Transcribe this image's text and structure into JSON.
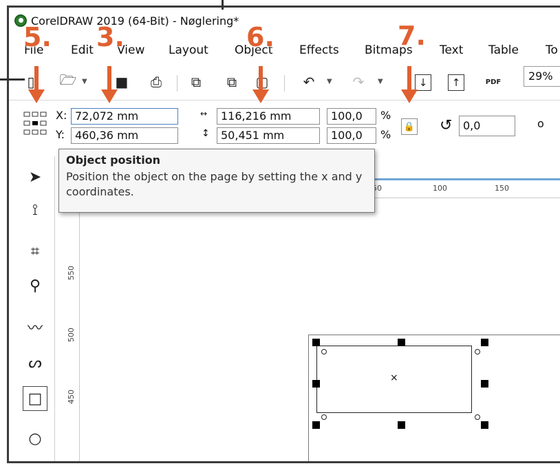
{
  "window": {
    "title": "CorelDRAW 2019 (64-Bit) - Nøglering*"
  },
  "menu": [
    "File",
    "Edit",
    "View",
    "Layout",
    "Object",
    "Effects",
    "Bitmaps",
    "Text",
    "Table",
    "To"
  ],
  "toolbar": {
    "zoom": "29%",
    "pdf_label": "PDF"
  },
  "properties": {
    "x_label": "X:",
    "x_value": "72,072 mm",
    "y_label": "Y:",
    "y_value": "460,36 mm",
    "width_value": "116,216 mm",
    "height_value": "50,451 mm",
    "scale_w": "100,0",
    "scale_h": "100,0",
    "pct": "%",
    "rotation": "0,0",
    "rotation_unit": "o"
  },
  "tooltip": {
    "title": "Object position",
    "body": "Position the object on the page by setting the x and y coordinates."
  },
  "ruler": {
    "top_ticks": [
      "50",
      "100",
      "150"
    ],
    "left_ticks": [
      "550",
      "500",
      "450"
    ]
  },
  "annotations": [
    "5.",
    "3.",
    "6.",
    "7."
  ],
  "colors": {
    "annotation": "#e06030",
    "ruler_accent": "#6fa6d6",
    "app_icon": "#2e7d32"
  }
}
